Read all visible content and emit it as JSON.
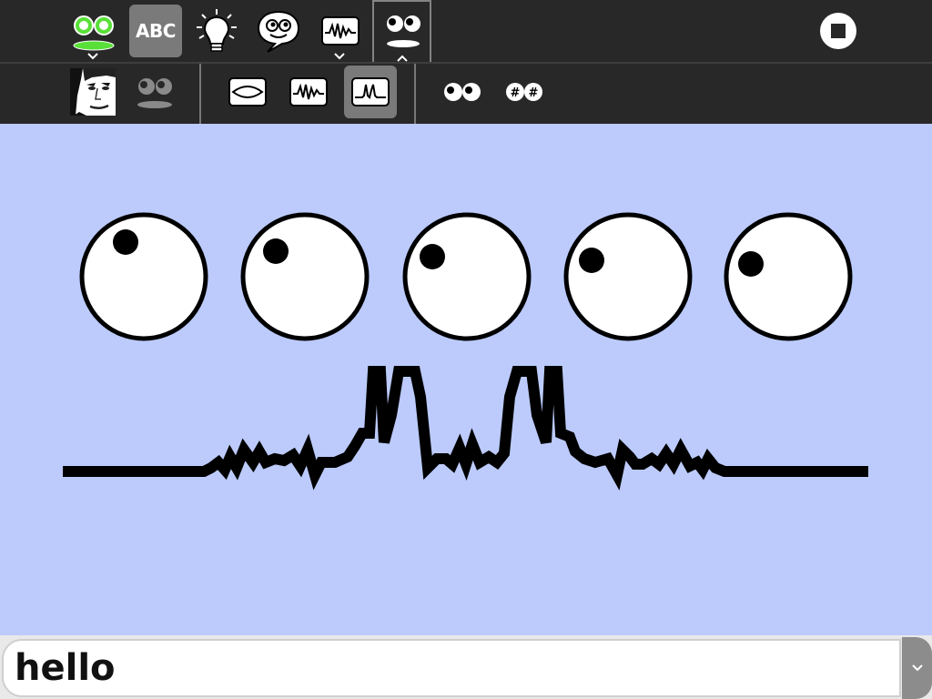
{
  "toolbar": {
    "items": [
      {
        "name": "activity-icon"
      },
      {
        "name": "abc-text-tool",
        "label": "ABC",
        "selected": true
      },
      {
        "name": "lightbulb-icon"
      },
      {
        "name": "speech-bubble-icon"
      },
      {
        "name": "waveform-icon",
        "has_menu": true
      },
      {
        "name": "face-icon",
        "expanded": true
      },
      {
        "name": "stop-icon"
      }
    ]
  },
  "subtoolbar": {
    "groups": [
      {
        "items": [
          {
            "name": "photo-face-icon"
          },
          {
            "name": "gray-face-icon"
          }
        ]
      },
      {
        "items": [
          {
            "name": "mouth-oval-icon"
          },
          {
            "name": "mouth-wave-icon"
          },
          {
            "name": "mouth-peak-icon",
            "selected": true
          }
        ]
      },
      {
        "items": [
          {
            "name": "eyes-round-icon"
          },
          {
            "name": "eyes-hash-icon"
          }
        ]
      }
    ]
  },
  "face": {
    "eye_count": 5,
    "colors": {
      "background": "#bccbfc",
      "eye_fill": "#ffffff",
      "ink": "#000000"
    }
  },
  "entry": {
    "value": "hello"
  },
  "colors": {
    "toolbar": "#282828",
    "selected_button": "#7a7a7a",
    "activity_green": "#59e038"
  }
}
